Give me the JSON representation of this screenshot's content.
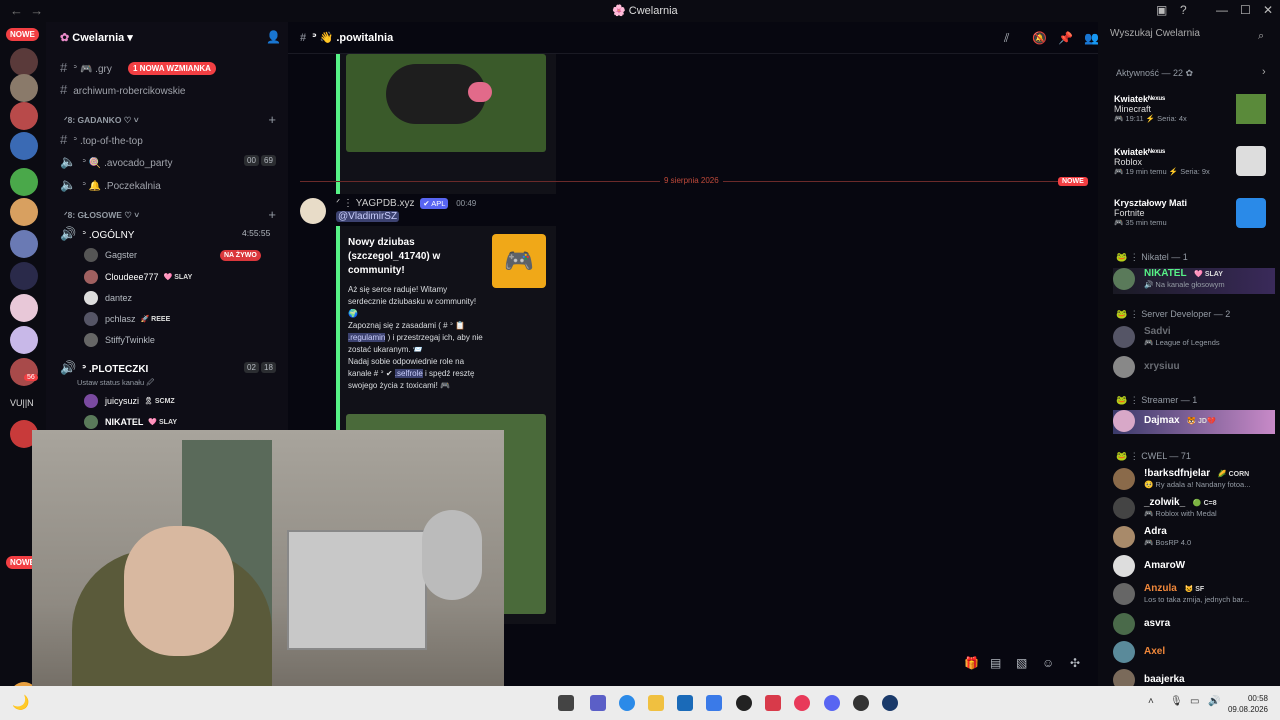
{
  "window": {
    "title": "Cwelarnia",
    "nav_back": "←",
    "nav_fwd": "→"
  },
  "servers": {
    "new_label_top": "NOWE",
    "new_label_bottom": "NOWE",
    "vujn": "VU||N",
    "badge_1": "1",
    "badge_56": "56"
  },
  "guild": {
    "name": "Cwelarnia ▾"
  },
  "channels": {
    "gry": "ᐣ 🎮 .gry",
    "mention_badge": "1 NOWA WZMIANKA",
    "archiwum": "archiwum-robercikowskie",
    "cat_gadanko": "ᐟ8: GADANKO ♡ ˅",
    "top": "ᐣ .top-of-the-top",
    "avocado": "ᐣ 🍭 .avocado_party",
    "avocado_n1": "00",
    "avocado_n2": "69",
    "poczekalnia": "ᐣ 🔔 .Poczekalnia",
    "cat_glosowe": "ᐟ8: GŁOSOWE ♡ ˅",
    "ogolny": "ᐣ .OGÓLNY",
    "ogolny_time": "4:55:55",
    "ploteczki": "ᐣ .PLOTECZKI",
    "ploteczki_status": "Ustaw status kanału 🖉",
    "plot_n1": "02",
    "plot_n2": "18"
  },
  "voice_users": [
    {
      "name": "Gagster",
      "tag": "",
      "live": "NA ŻYWO"
    },
    {
      "name": "Cloudeee777",
      "tag": "🩷 SLAY",
      "live": ""
    },
    {
      "name": "dantez",
      "tag": "",
      "live": ""
    },
    {
      "name": "pchlasz",
      "tag": "🚀 REEE",
      "live": ""
    },
    {
      "name": "StiffyTwinkle",
      "tag": "",
      "live": ""
    },
    {
      "name": "juicysuzi",
      "tag": "🎗 SCMZ",
      "live": ""
    },
    {
      "name": "NIKATEL",
      "tag": "🩷 SLAY",
      "live": ""
    }
  ],
  "chat": {
    "channel_name": "ᐣ 👋 .powitalnia",
    "divider_date": "9 sierpnia 2026",
    "divider_new": "NOWE",
    "author": "ᐟ ⋮ YAGPDB.xyz",
    "app_tag": "✔ APL",
    "time": "00:49",
    "mention": "@VladimirSZ",
    "embed_title": "Nowy dziubas (szczegol_41740) w community!",
    "embed_body_1": "Aż się serce raduje! Witamy serdecznie dziubasku w community! 🌍",
    "embed_body_2": "Zapoznaj się z zasadami ( # ᐣ 📋",
    "embed_link_1": ".regulamin",
    "embed_body_3": ") i przestrzegaj ich, aby nie zostać ukaranym. 📨",
    "embed_body_4": "Nadaj sobie odpowiednie role na kanale # ᐣ ✔",
    "embed_link_2": ".selfrole",
    "embed_body_5": "i spędź resztę swojego życia z toxicami! 🎮"
  },
  "right": {
    "search_placeholder": "Wyszukaj Cwelarnia",
    "activity_header": "Aktywność — 22 ✿",
    "activities": [
      {
        "user": "Kwiatekᴺᵉˣᵘˢ",
        "game": "Minecraft",
        "meta": "🎮 19:11  ⚡ Seria: 4x"
      },
      {
        "user": "Kwiatekᴺᵉˣᵘˢ",
        "game": "Roblox",
        "meta": "🎮 19 min temu  ⚡ Seria: 9x"
      },
      {
        "user": "Kryształowy Mati",
        "game": "Fortnite",
        "meta": "🎮 35 min temu"
      }
    ],
    "sec_nikatel": "🐸 ⋮ Nikatel — 1",
    "sec_serverdev": "🐸 ⋮ Server Developer — 2",
    "sec_streamer": "🐸 ⋮ Streamer — 1",
    "sec_cwel": "🐸 ⋮ CWEL — 71",
    "members": [
      {
        "name": "NIKATEL",
        "tag": "🩷 SLAY",
        "sub": "🔊 Na kanale głosowym",
        "color": "#57f287"
      },
      {
        "name": "Sadvi",
        "tag": "",
        "sub": "🎮 League of Legends",
        "color": "#6a6d74"
      },
      {
        "name": "xrysiuu",
        "tag": "",
        "sub": "",
        "color": "#6a6d74"
      },
      {
        "name": "Dajmax",
        "tag": "🐯 JD💔",
        "sub": "",
        "color": "#ffffff"
      },
      {
        "name": "!barksdfnjelar",
        "tag": "🌽 CORN",
        "sub": "🥺 Ry adala a! Nandany fotoa...",
        "color": "#ffffff"
      },
      {
        "name": "_zolwik_",
        "tag": "🟢 C=8",
        "sub": "🎮 Roblox with Medal",
        "color": "#ffffff"
      },
      {
        "name": "Adra",
        "tag": "",
        "sub": "🎮 BosRP 4.0",
        "color": "#ffffff"
      },
      {
        "name": "AmaroW",
        "tag": "",
        "sub": "",
        "color": "#ffffff"
      },
      {
        "name": "Anzula",
        "tag": "😺 SF",
        "sub": "Los to taka zmija, jednych bar...",
        "color": "#f0873a"
      },
      {
        "name": "asvra",
        "tag": "",
        "sub": "",
        "color": "#ffffff"
      },
      {
        "name": "Axel",
        "tag": "",
        "sub": "",
        "color": "#f0873a"
      },
      {
        "name": "baajerka",
        "tag": "",
        "sub": "",
        "color": "#ffffff"
      }
    ]
  },
  "taskbar": {
    "time": "00:58",
    "date": "09.08.2026"
  }
}
